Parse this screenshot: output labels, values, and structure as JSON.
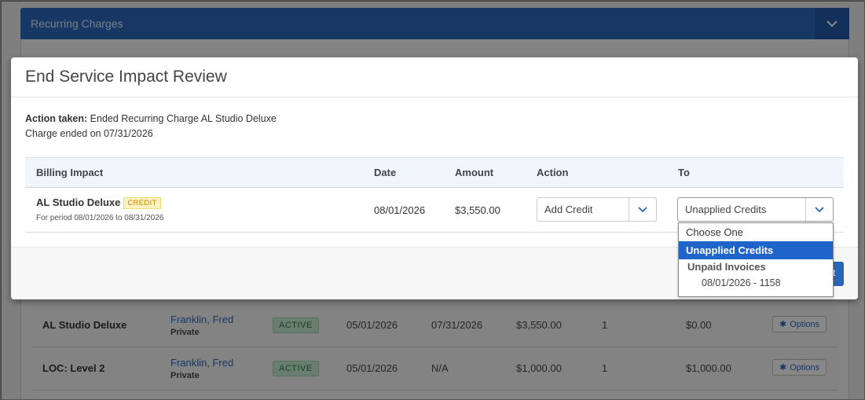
{
  "background": {
    "section_title": "Recurring Charges",
    "rows": [
      {
        "name": "AL Studio Deluxe",
        "client": "Franklin, Fred",
        "client_sub": "Private",
        "status": "ACTIVE",
        "start": "05/01/2026",
        "end": "07/31/2026",
        "amount": "$3,550.00",
        "qty": "1",
        "balance": "$0.00",
        "options": "Options"
      },
      {
        "name": "LOC: Level 2",
        "client": "Franklin, Fred",
        "client_sub": "Private",
        "status": "ACTIVE",
        "start": "05/01/2026",
        "end": "N/A",
        "amount": "$1,000.00",
        "qty": "1",
        "balance": "$1,000.00",
        "options": "Options"
      }
    ]
  },
  "modal": {
    "title": "End Service Impact Review",
    "action_taken_label": "Action taken:",
    "action_taken_text": " Ended Recurring Charge AL Studio Deluxe",
    "charge_ended": "Charge ended on 07/31/2026",
    "table": {
      "headers": {
        "billing_impact": "Billing Impact",
        "date": "Date",
        "amount": "Amount",
        "action": "Action",
        "to": "To"
      },
      "row": {
        "name": "AL Studio Deluxe",
        "badge": "CREDIT",
        "period": "For period 08/01/2026 to 08/31/2026",
        "date": "08/01/2026",
        "amount": "$3,550.00",
        "action_value": "Add Credit",
        "to_value": "Unapplied Credits"
      }
    },
    "footer_button_fragment": "t"
  },
  "dropdown": {
    "options": [
      {
        "label": "Choose One",
        "selected": false
      },
      {
        "label": "Unapplied Credits",
        "selected": true
      }
    ],
    "group_label": "Unpaid Invoices",
    "group_items": [
      "08/01/2026 - 1158"
    ]
  },
  "colors": {
    "primary": "#2a66b6",
    "selected_option": "#1f64c9",
    "active_badge": "#bfe6c8",
    "credit_badge": "#fff2c2"
  }
}
